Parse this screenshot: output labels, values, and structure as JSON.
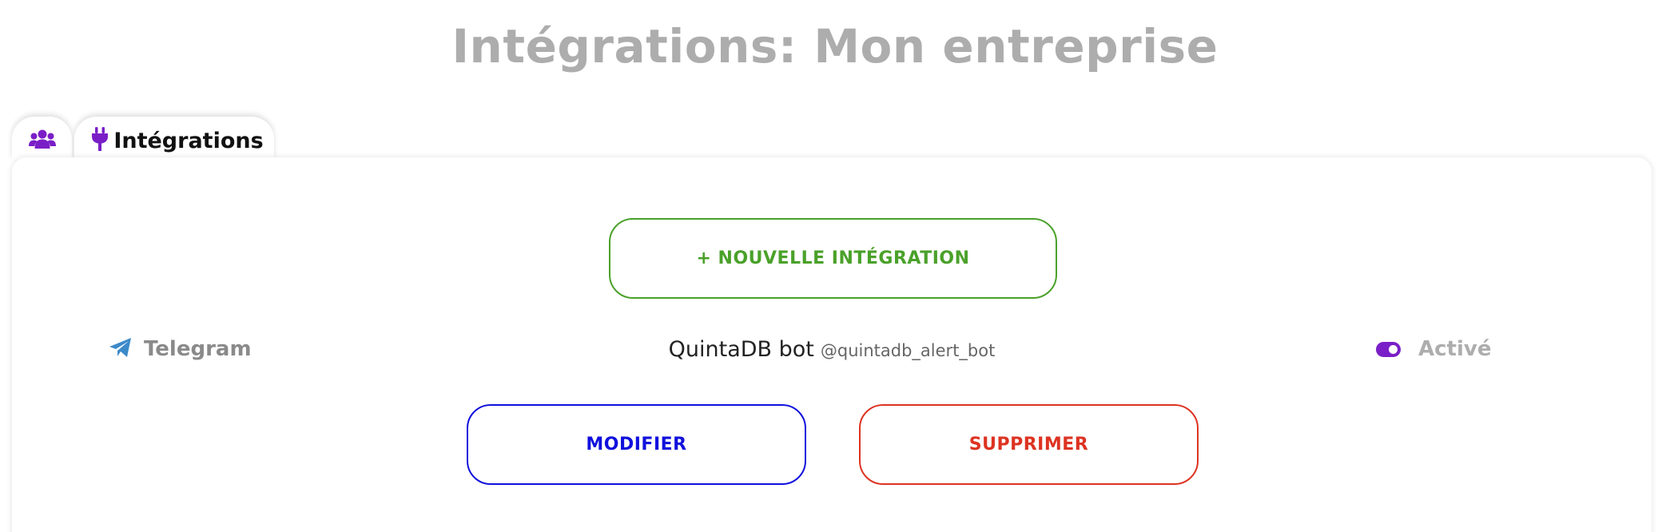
{
  "page": {
    "title": "Intégrations: Mon entreprise"
  },
  "tabs": [
    {
      "id": "users",
      "label": "",
      "icon": "users-icon",
      "icon_color": "#7a1fc7"
    },
    {
      "id": "integrations",
      "label": "Intégrations",
      "icon": "plug-icon",
      "icon_color": "#7a1fc7",
      "active": true
    }
  ],
  "actions": {
    "new_integration_label": "+ NOUVELLE INTÉGRATION",
    "edit_label": "MODIFIER",
    "delete_label": "SUPPRIMER"
  },
  "integration": {
    "type_label": "Telegram",
    "type_icon": "telegram-icon",
    "bot_name": "QuintaDB bot",
    "bot_handle": "@quintadb_alert_bot",
    "enabled": true,
    "status_label": "Activé"
  },
  "colors": {
    "title": "#adadad",
    "accent_purple": "#7a1fc7",
    "new_button": "#4aa12a",
    "edit_button": "#1010dd",
    "delete_button": "#dd3322",
    "telegram_blue": "#3d8ac9"
  }
}
